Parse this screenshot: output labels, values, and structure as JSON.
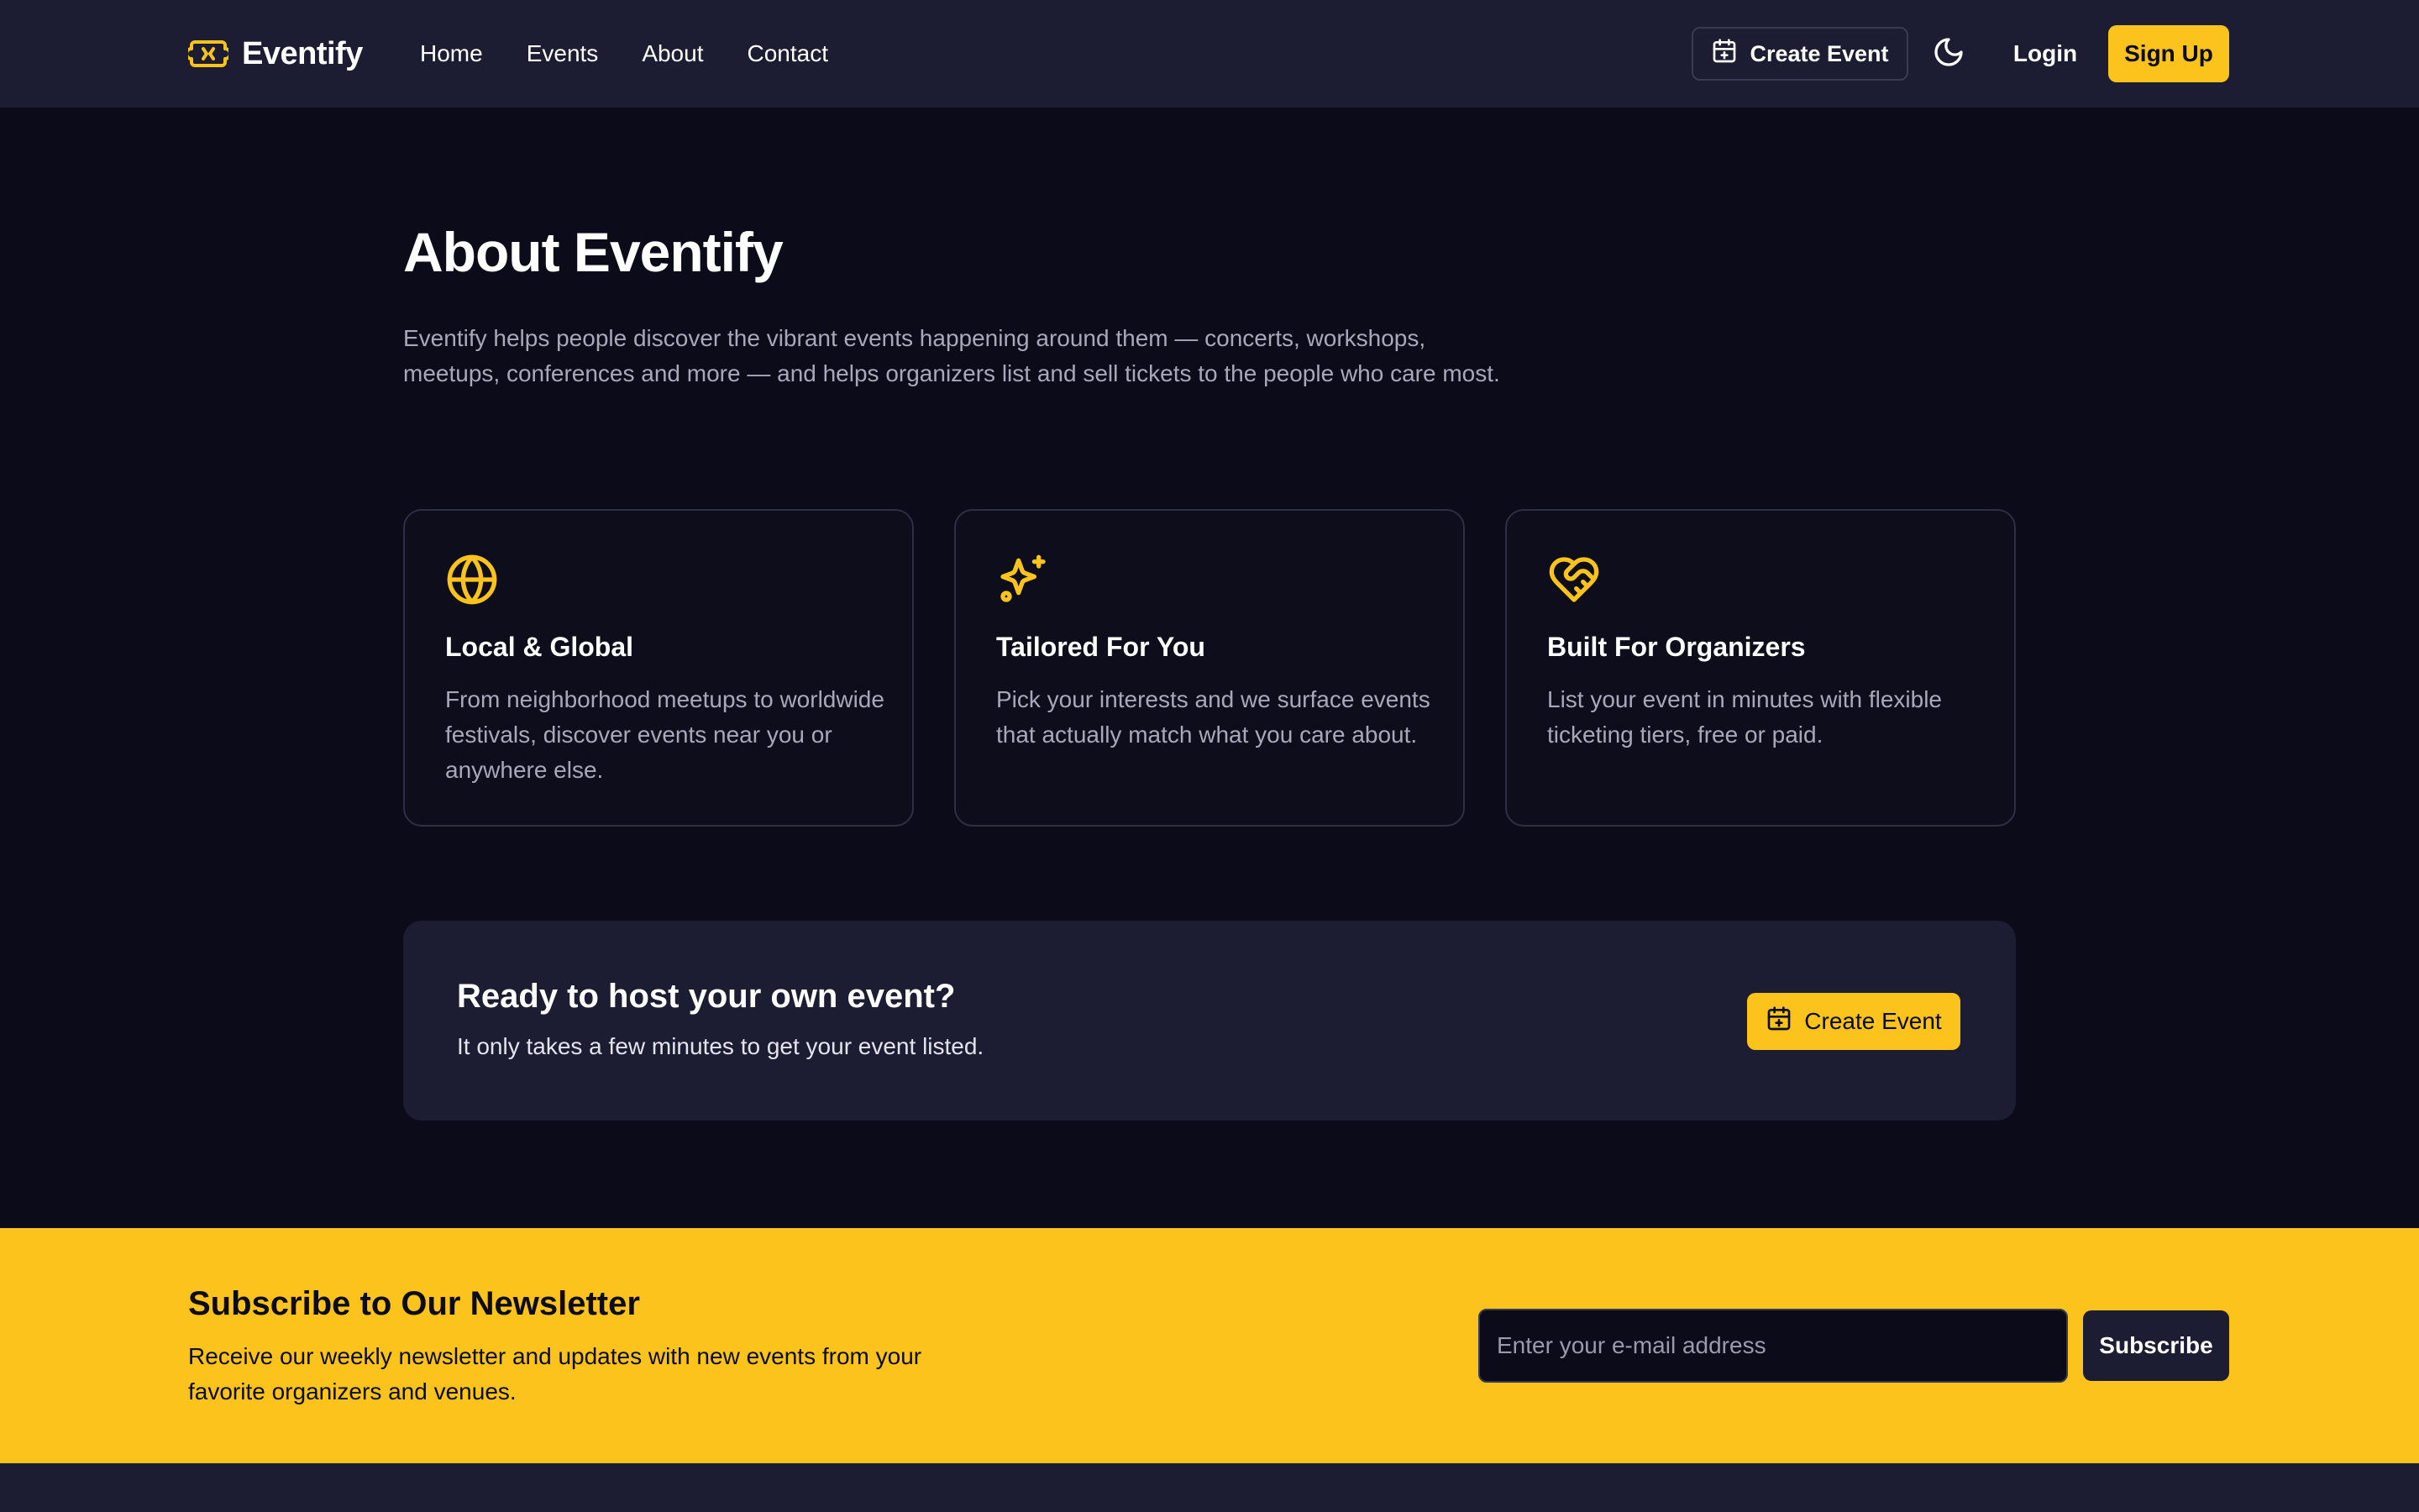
{
  "header": {
    "brand": "Eventify",
    "nav": [
      "Home",
      "Events",
      "About",
      "Contact"
    ],
    "create_event_label": "Create Event",
    "login_label": "Login",
    "signup_label": "Sign Up"
  },
  "about": {
    "title": "About Eventify",
    "description": "Eventify helps people discover the vibrant events happening around them — concerts, workshops, meetups, conferences and more — and helps organizers list and sell tickets to the people who care most."
  },
  "features": [
    {
      "icon": "globe-icon",
      "title": "Local & Global",
      "description": "From neighborhood meetups to worldwide festivals, discover events near you or anywhere else."
    },
    {
      "icon": "sparkles-icon",
      "title": "Tailored For You",
      "description": "Pick your interests and we surface events that actually match what you care about."
    },
    {
      "icon": "heart-handshake-icon",
      "title": "Built For Organizers",
      "description": "List your event in minutes with flexible ticketing tiers, free or paid."
    }
  ],
  "cta": {
    "title": "Ready to host your own event?",
    "subtitle": "It only takes a few minutes to get your event listed.",
    "button_label": "Create Event"
  },
  "newsletter": {
    "title": "Subscribe to Our Newsletter",
    "text": "Receive our weekly newsletter and updates with new events from your favorite organizers and venues.",
    "input_placeholder": "Enter your e-mail address",
    "button_label": "Subscribe"
  },
  "colors": {
    "accent": "#fbc31b",
    "background": "#0b0b19",
    "surface": "#1c1c33",
    "muted_text": "#a8a8b8"
  }
}
